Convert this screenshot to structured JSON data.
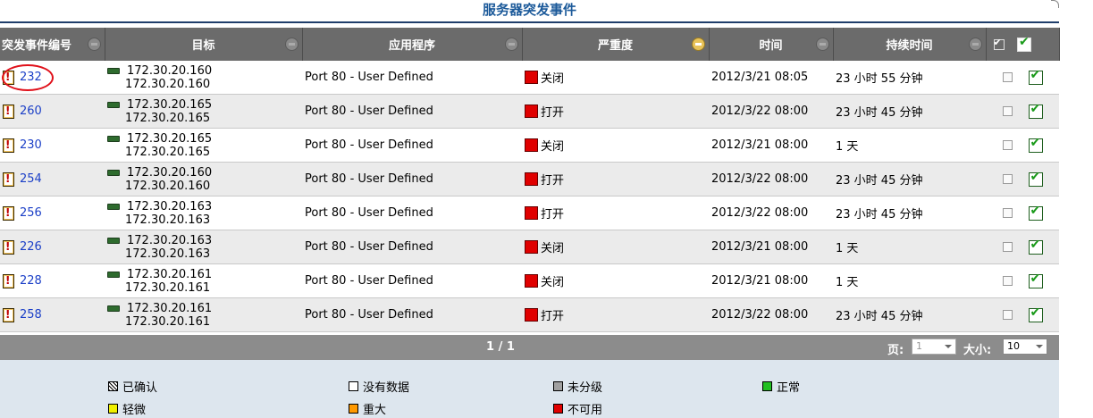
{
  "title": "服务器突发事件",
  "columns": [
    {
      "label": "突发事件编号"
    },
    {
      "label": "目标"
    },
    {
      "label": "应用程序"
    },
    {
      "label": "严重度"
    },
    {
      "label": "时间"
    },
    {
      "label": "持续时间"
    }
  ],
  "rows": [
    {
      "id": "232",
      "ip1": "172.30.20.160",
      "ip2": "172.30.20.160",
      "app": "Port 80 - User Defined",
      "severity": "关闭",
      "time": "2012/3/21 08:05",
      "duration": "23 小时 55 分钟"
    },
    {
      "id": "260",
      "ip1": "172.30.20.165",
      "ip2": "172.30.20.165",
      "app": "Port 80 - User Defined",
      "severity": "打开",
      "time": "2012/3/22 08:00",
      "duration": "23 小时 45 分钟"
    },
    {
      "id": "230",
      "ip1": "172.30.20.165",
      "ip2": "172.30.20.165",
      "app": "Port 80 - User Defined",
      "severity": "关闭",
      "time": "2012/3/21 08:00",
      "duration": "1 天"
    },
    {
      "id": "254",
      "ip1": "172.30.20.160",
      "ip2": "172.30.20.160",
      "app": "Port 80 - User Defined",
      "severity": "打开",
      "time": "2012/3/22 08:00",
      "duration": "23 小时 45 分钟"
    },
    {
      "id": "256",
      "ip1": "172.30.20.163",
      "ip2": "172.30.20.163",
      "app": "Port 80 - User Defined",
      "severity": "打开",
      "time": "2012/3/22 08:00",
      "duration": "23 小时 45 分钟"
    },
    {
      "id": "226",
      "ip1": "172.30.20.163",
      "ip2": "172.30.20.163",
      "app": "Port 80 - User Defined",
      "severity": "关闭",
      "time": "2012/3/21 08:00",
      "duration": "1 天"
    },
    {
      "id": "228",
      "ip1": "172.30.20.161",
      "ip2": "172.30.20.161",
      "app": "Port 80 - User Defined",
      "severity": "关闭",
      "time": "2012/3/21 08:00",
      "duration": "1 天"
    },
    {
      "id": "258",
      "ip1": "172.30.20.161",
      "ip2": "172.30.20.161",
      "app": "Port 80 - User Defined",
      "severity": "打开",
      "time": "2012/3/22 08:00",
      "duration": "23 小时 45 分钟"
    }
  ],
  "pager": {
    "page_count": "1 / 1",
    "page_label": "页:",
    "page_value": "1",
    "size_label": "大小:",
    "size_value": "10"
  },
  "legend": [
    {
      "label": "已确认",
      "color": "hatch"
    },
    {
      "label": "没有数据",
      "color": "#ffffff"
    },
    {
      "label": "未分级",
      "color": "#a0a0a0"
    },
    {
      "label": "正常",
      "color": "#22c022"
    },
    {
      "label": "轻微",
      "color": "#f0f000"
    },
    {
      "label": "重大",
      "color": "#ff9900"
    },
    {
      "label": "不可用",
      "color": "#e00000"
    }
  ],
  "colors": {
    "severity_red": "#e00000",
    "header_bg": "#6b6b6b",
    "link": "#1b3fc7",
    "title": "#1c5a9a"
  }
}
